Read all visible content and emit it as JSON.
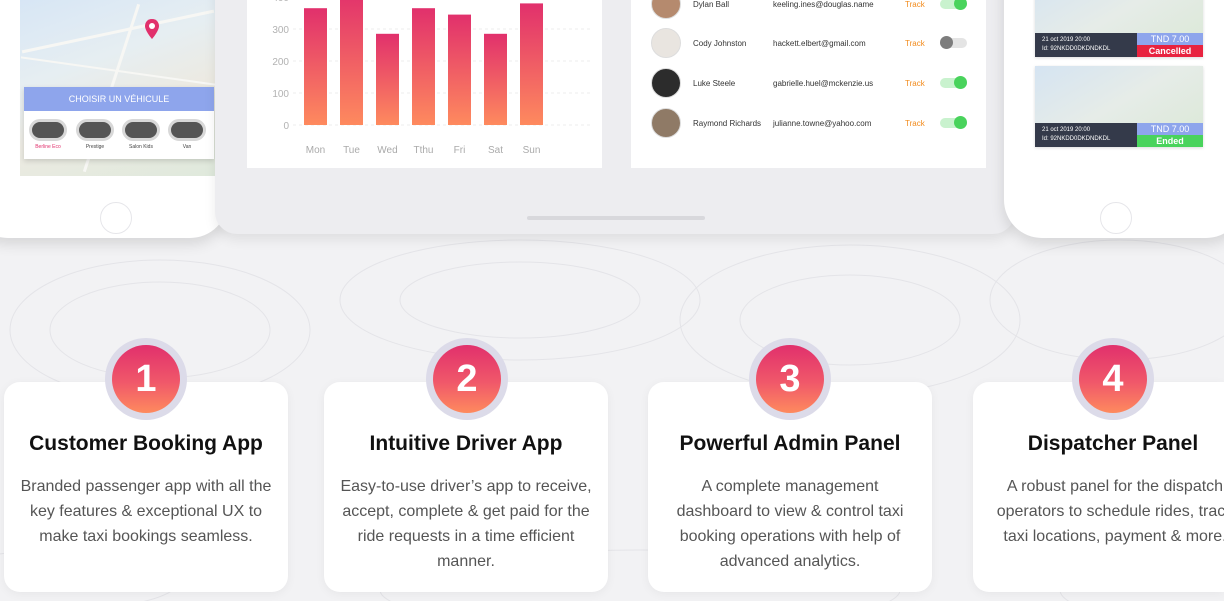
{
  "customer_app": {
    "panel_title": "CHOISIR UN VÉHICULE",
    "vehicles": [
      {
        "label": "Berline Eco",
        "selected": true
      },
      {
        "label": "Prestige",
        "selected": false
      },
      {
        "label": "Salon Kids",
        "selected": false
      },
      {
        "label": "Van",
        "selected": false
      }
    ]
  },
  "chart_data": {
    "type": "bar",
    "categories": [
      "Mon",
      "Tue",
      "Wed",
      "Tthu",
      "Fri",
      "Sat",
      "Sun"
    ],
    "values": [
      365,
      420,
      285,
      365,
      345,
      285,
      380
    ],
    "y_ticks": [
      "400",
      "300",
      "200",
      "100",
      "0"
    ],
    "ylim": [
      0,
      400
    ],
    "grid": true
  },
  "drivers": [
    {
      "name": "Dylan Ball",
      "email": "keeling.ines@douglas.name",
      "action": "Track",
      "active": true
    },
    {
      "name": "Cody Johnston",
      "email": "hackett.elbert@gmail.com",
      "action": "Track",
      "active": false
    },
    {
      "name": "Luke Steele",
      "email": "gabrielle.huel@mckenzie.us",
      "action": "Track",
      "active": true
    },
    {
      "name": "Raymond Richards",
      "email": "julianne.towne@yahoo.com",
      "action": "Track",
      "active": true
    }
  ],
  "rides": [
    {
      "date": "21 oct 2019  20:00",
      "id": "Id: 92NKDD0DKDNDKDL",
      "price": "TND 7.00",
      "status": "Cancelled",
      "status_color": "#e8233f"
    },
    {
      "date": "21 oct 2019  20:00",
      "id": "Id: 92NKDD0DKDNDKDL",
      "price": "TND 7.00",
      "status": "Ended",
      "status_color": "#49d35c"
    }
  ],
  "features": [
    {
      "number": "1",
      "title": "Customer Booking App",
      "description": "Branded passenger app with all the key features & exceptional UX to make taxi bookings seamless."
    },
    {
      "number": "2",
      "title": "Intuitive Driver App",
      "description": "Easy-to-use driver’s app to receive, accept, complete & get paid for the ride requests in a time efficient manner."
    },
    {
      "number": "3",
      "title": "Powerful Admin Panel",
      "description": "A complete management dashboard to view & control taxi booking operations with help of advanced analytics."
    },
    {
      "number": "4",
      "title": "Dispatcher Panel",
      "description": "A robust panel for the dispatch operators to schedule rides, track taxi locations, payment & more."
    }
  ],
  "colors": {
    "accent": "#e1306c",
    "accent_end": "#fe8a5e",
    "panel_blue": "#8ea5ec",
    "track_orange": "#f28b1c",
    "toggle_green": "#49d35c"
  }
}
